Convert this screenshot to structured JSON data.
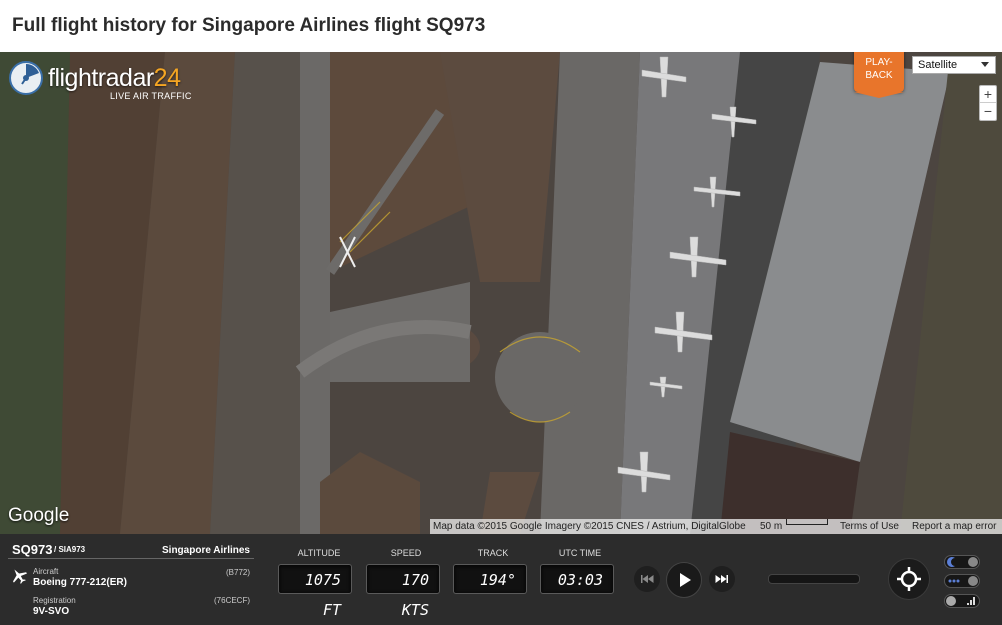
{
  "page": {
    "title": "Full flight history for Singapore Airlines flight SQ973"
  },
  "map": {
    "logo_text": "flightradar",
    "logo_number": "24",
    "logo_tagline": "LIVE AIR TRAFFIC",
    "playback_label_line1": "PLAY-",
    "playback_label_line2": "BACK",
    "map_type": "Satellite",
    "zoom_in": "+",
    "zoom_out": "−",
    "google_logo": "Google",
    "attribution": "Map data ©2015 Google Imagery ©2015 CNES / Astrium, DigitalGlobe",
    "scale_label": "50 m",
    "terms_link": "Terms of Use",
    "report_link": "Report a map error"
  },
  "flight": {
    "flight_number": "SQ973",
    "callsign": "/ SIA973",
    "airline": "Singapore Airlines",
    "aircraft_label": "Aircraft",
    "aircraft_value": "Boeing 777-212(ER)",
    "aircraft_code": "(B772)",
    "registration_label": "Registration",
    "registration_value": "9V-SVO",
    "registration_code": "(76CECF)"
  },
  "gauges": {
    "altitude_label": "ALTITUDE",
    "altitude_value": "1075 FT",
    "speed_label": "SPEED",
    "speed_value": "170 KTS",
    "track_label": "TRACK",
    "track_value": "194°",
    "utc_label": "UTC TIME",
    "utc_value": "03:03"
  },
  "playback_controls": {
    "progress": 0
  },
  "icons": {
    "plane": "airplane-icon",
    "rewind": "rewind-icon",
    "play": "play-icon",
    "fast_forward": "fast-forward-icon",
    "locate": "crosshair-icon",
    "night": "moon-icon",
    "dots": "dots-icon",
    "chart": "chart-icon"
  },
  "colors": {
    "accent": "#e8752b",
    "panel": "#2c2c2c"
  }
}
